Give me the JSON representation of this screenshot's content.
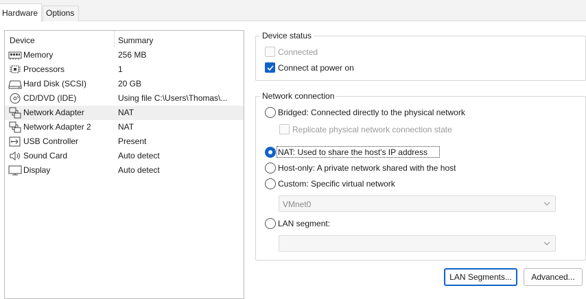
{
  "tabs": [
    {
      "label": "Hardware",
      "active": true
    },
    {
      "label": "Options",
      "active": false
    }
  ],
  "device_list": {
    "columns": [
      "Device",
      "Summary"
    ],
    "rows": [
      {
        "icon": "memory-icon",
        "device": "Memory",
        "summary": "256 MB"
      },
      {
        "icon": "processor-icon",
        "device": "Processors",
        "summary": "1"
      },
      {
        "icon": "hard-disk-icon",
        "device": "Hard Disk (SCSI)",
        "summary": "20 GB"
      },
      {
        "icon": "cd-dvd-icon",
        "device": "CD/DVD (IDE)",
        "summary": "Using file C:\\Users\\Thomas\\..."
      },
      {
        "icon": "network-adapter-icon",
        "device": "Network Adapter",
        "summary": "NAT",
        "selected": true
      },
      {
        "icon": "network-adapter-icon",
        "device": "Network Adapter 2",
        "summary": "NAT"
      },
      {
        "icon": "usb-icon",
        "device": "USB Controller",
        "summary": "Present"
      },
      {
        "icon": "speaker-icon",
        "device": "Sound Card",
        "summary": "Auto detect"
      },
      {
        "icon": "display-icon",
        "device": "Display",
        "summary": "Auto detect"
      }
    ]
  },
  "device_status": {
    "title": "Device status",
    "connected": {
      "label": "Connected",
      "checked": false,
      "enabled": false
    },
    "connect_at_power_on": {
      "label": "Connect at power on",
      "checked": true,
      "enabled": true
    }
  },
  "network_connection": {
    "title": "Network connection",
    "bridged": {
      "label": "Bridged: Connected directly to the physical network",
      "selected": false
    },
    "replicate": {
      "label": "Replicate physical network connection state",
      "checked": false,
      "enabled": false
    },
    "nat": {
      "label": "NAT: Used to share the host's IP address",
      "selected": true
    },
    "host_only": {
      "label": "Host-only: A private network shared with the host",
      "selected": false
    },
    "custom": {
      "label": "Custom: Specific virtual network",
      "selected": false
    },
    "custom_network": {
      "value": "VMnet0",
      "enabled": false
    },
    "lan_segment": {
      "label": "LAN segment:",
      "selected": false
    },
    "lan_segment_value": {
      "value": "",
      "enabled": false
    }
  },
  "buttons": {
    "lan_segments": "LAN Segments...",
    "advanced": "Advanced..."
  },
  "colors": {
    "accent": "#0f63c7",
    "selected_row": "#efefef"
  }
}
